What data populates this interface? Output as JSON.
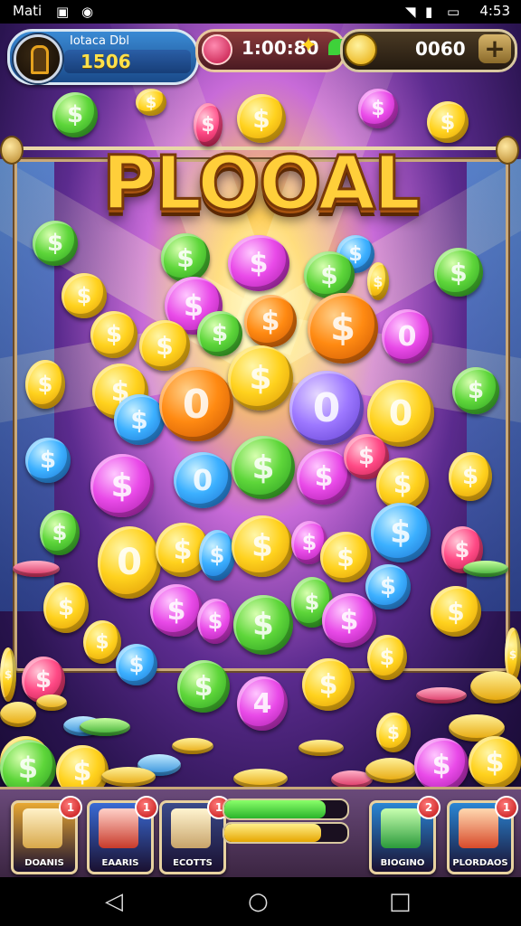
{
  "status_bar": {
    "left_text": "Mati",
    "time": "4:53"
  },
  "hud": {
    "level_label": "Iotaca Dbl",
    "level_value": "1506",
    "gems_value": "1:00:80",
    "coins_value": "0060",
    "plus_label": "+"
  },
  "title": "PLOOAL",
  "bottom": {
    "tools": [
      {
        "label": "DOANIS",
        "badge": "1",
        "color": "#e8a832"
      },
      {
        "label": "EAARIS",
        "badge": "1",
        "color": "#3a6ad4"
      },
      {
        "label": "ECOTTS",
        "badge": "1",
        "color": "#3a4a8a"
      },
      {
        "label": "BIOGINO",
        "badge": "2",
        "color": "#2a86d4"
      },
      {
        "label": "PLORDAOS",
        "badge": "1",
        "color": "#2a86d4"
      }
    ],
    "progress_green": 0.82,
    "progress_yellow": 0.79
  },
  "colors": {
    "green_bar": "#3ed23a",
    "yellow_bar": "#ffd21e"
  },
  "icons": {
    "level_avatar": "keyhole-door-icon",
    "gem": "red-gem-icon",
    "coin": "gold-coin-icon",
    "plus": "plus-icon",
    "nav_back": "triangle-back-icon",
    "nav_home": "circle-home-icon",
    "nav_recent": "square-recent-icon"
  }
}
